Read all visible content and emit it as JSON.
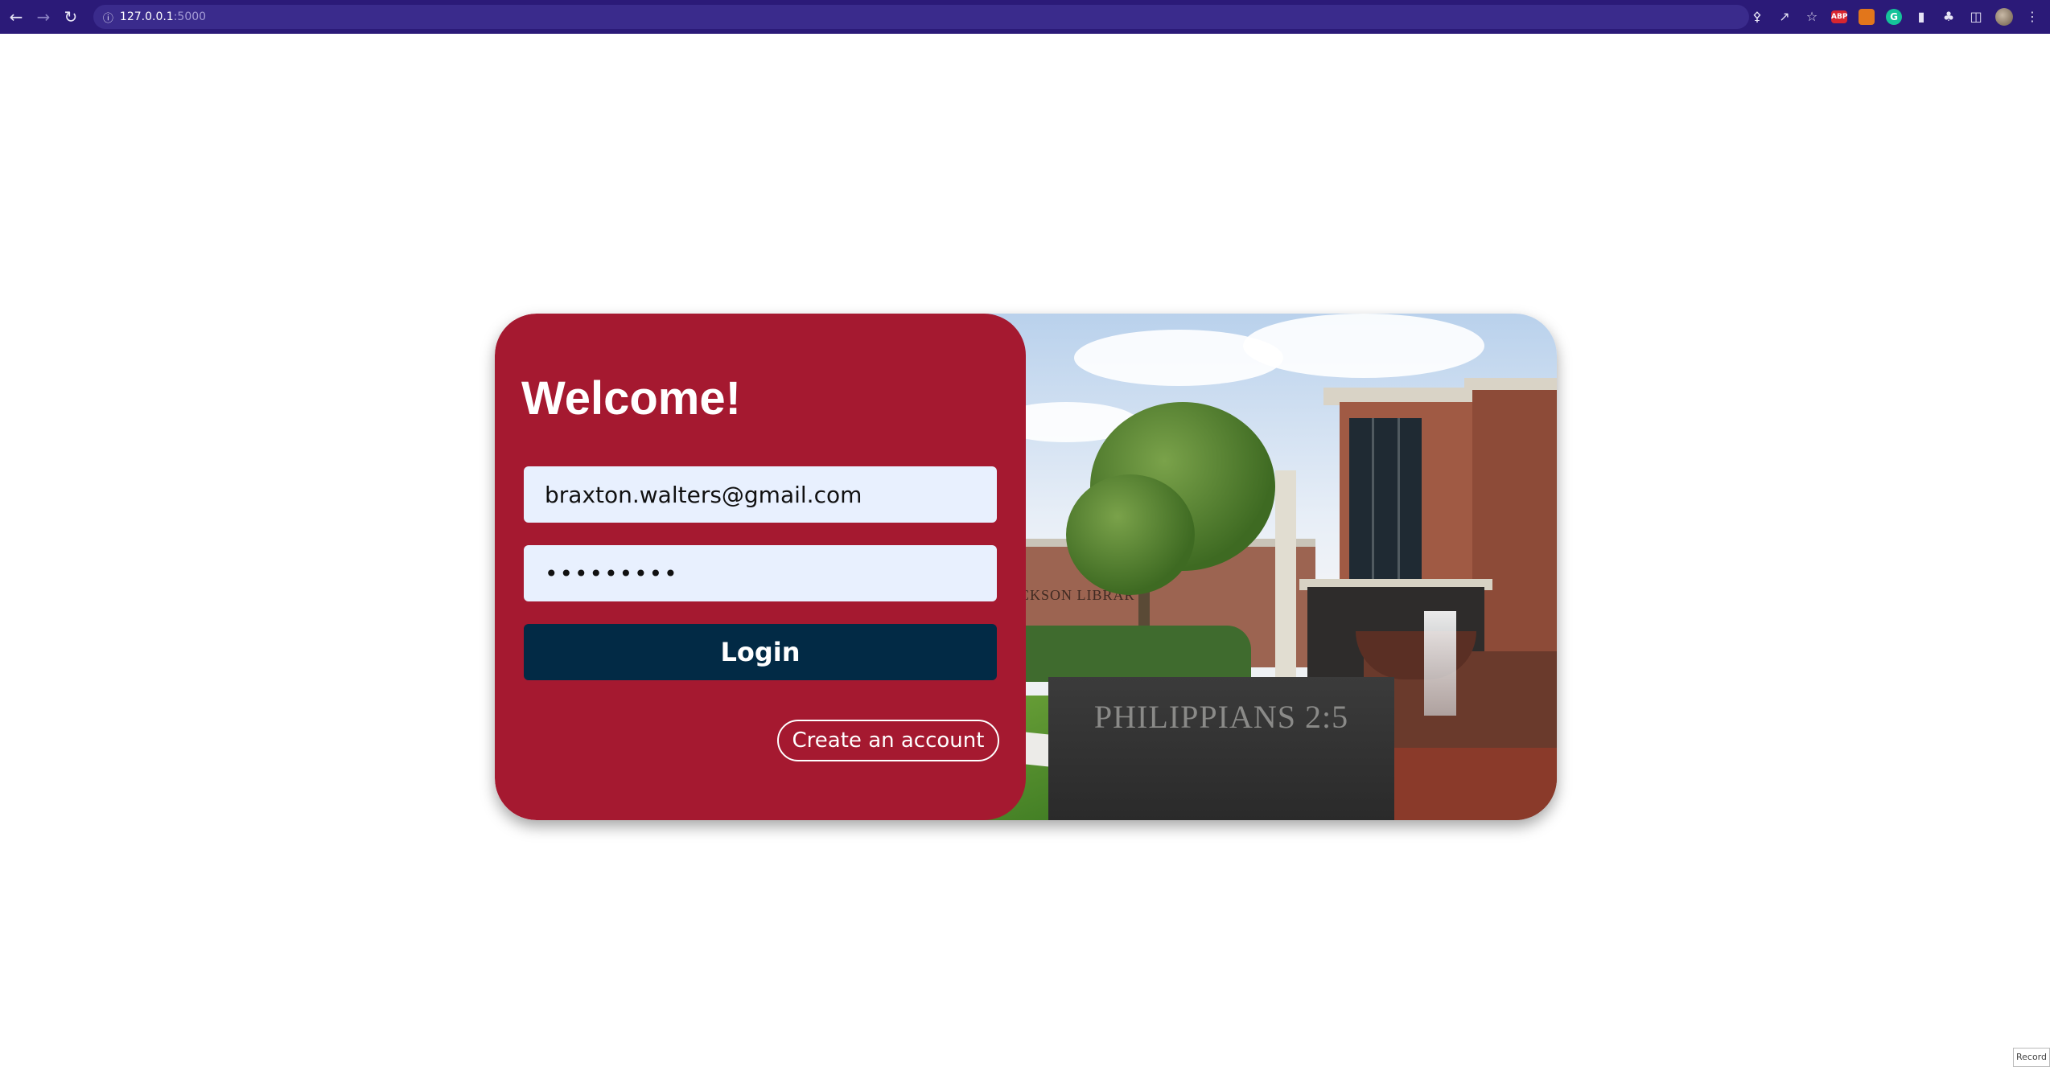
{
  "browser": {
    "address_host": "127.0.0.1",
    "address_port": ":5000",
    "back_icon": "arrow-left-icon",
    "forward_icon": "arrow-right-icon",
    "reload_icon": "reload-icon",
    "info_icon": "info-icon",
    "toolbar_icons": [
      "key-icon",
      "share-icon",
      "star-icon",
      "adblock-icon",
      "metamask-icon",
      "grammarly-icon",
      "extension-icon",
      "puzzle-icon",
      "sidepanel-icon",
      "profile-avatar",
      "more-menu-icon"
    ],
    "adblock_label": "ABP",
    "grammarly_label": "G"
  },
  "login": {
    "title": "Welcome!",
    "email_value": "braxton.walters@gmail.com",
    "password_value": "•••••••••",
    "login_label": "Login",
    "create_account_label": "Create an account"
  },
  "photo": {
    "library_sign": "JACKSON LIBRAR",
    "monument_text": "PHILIPPIANS 2:5"
  },
  "footer": {
    "record_label": "Record"
  },
  "colors": {
    "browser_bar": "#2b1a78",
    "login_panel": "#a51930",
    "input_bg": "#e8f0fe",
    "login_button": "#022a45",
    "page_bg": "#ffffff"
  }
}
